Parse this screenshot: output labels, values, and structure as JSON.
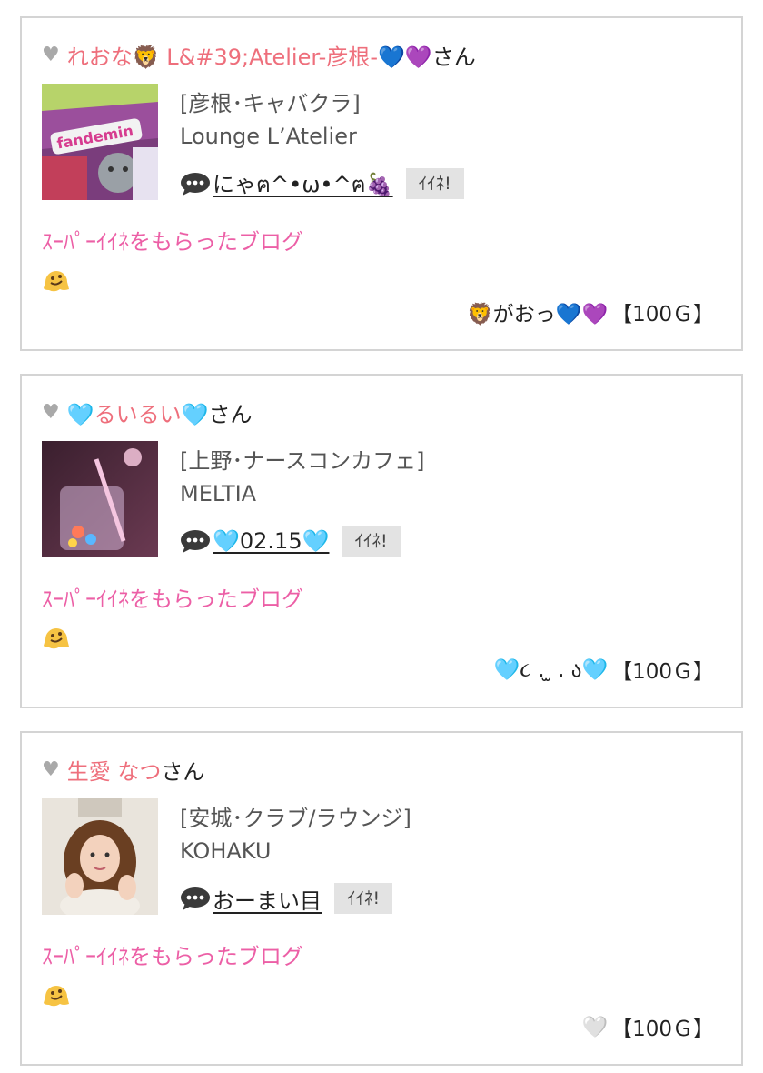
{
  "colors": {
    "name_pink": "#ee6f7c",
    "super_pink": "#ec5fa6",
    "border": "#d4d4d4",
    "iine_bg": "#e3e3e3"
  },
  "cards": [
    {
      "heart_icon": "♥",
      "name": "れおな🦁 L&#39;Atelier-彦根-💙💜",
      "suffix": "さん",
      "thumb_icon": "photo-candy-package",
      "category": "[彦根･キャバクラ]",
      "shop": "Lounge L’Atelier",
      "chat_icon": "speech-bubble-icon",
      "blog_title": "にゃฅ^•ω•^ฅ🍇",
      "iine_label": "ｲｲﾈ!",
      "super_label": "ｽｰﾊﾟｰｲｲﾈをもらったブログ",
      "smile_icon": "melting-face-icon",
      "gift_message": "🦁がおっ💙💜",
      "gift_amount": "【100Ｇ】"
    },
    {
      "heart_icon": "♥",
      "name": "🩵るいるい🩵",
      "suffix": "さん",
      "thumb_icon": "photo-glass-drink",
      "category": "[上野･ナースコンカフェ]",
      "shop": "MELTIA",
      "chat_icon": "speech-bubble-icon",
      "blog_title": "🩵02.15🩵",
      "iine_label": "ｲｲﾈ!",
      "super_label": "ｽｰﾊﾟｰｲｲﾈをもらったブログ",
      "smile_icon": "melting-face-icon",
      "gift_message": "🩵૮ . ̫ . ა🩵",
      "gift_amount": "【100Ｇ】"
    },
    {
      "heart_icon": "♥",
      "name": "生愛 なつ",
      "suffix": "さん",
      "thumb_icon": "photo-portrait",
      "category": "[安城･クラブ/ラウンジ]",
      "shop": "KOHAKU",
      "chat_icon": "speech-bubble-icon",
      "blog_title": "おーまい目",
      "iine_label": "ｲｲﾈ!",
      "super_label": "ｽｰﾊﾟｰｲｲﾈをもらったブログ",
      "smile_icon": "melting-face-icon",
      "gift_message": "🤍",
      "gift_amount": "【100Ｇ】"
    }
  ]
}
